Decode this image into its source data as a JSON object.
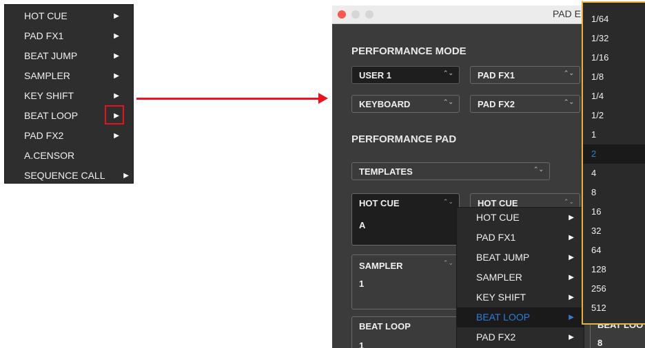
{
  "left_menu": {
    "items": [
      {
        "label": "HOT CUE",
        "arrow": "▶"
      },
      {
        "label": "PAD FX1",
        "arrow": "▶"
      },
      {
        "label": "BEAT JUMP",
        "arrow": "▶"
      },
      {
        "label": "SAMPLER",
        "arrow": "▶"
      },
      {
        "label": "KEY SHIFT",
        "arrow": "▶"
      },
      {
        "label": "BEAT LOOP",
        "arrow": "▶"
      },
      {
        "label": "PAD FX2",
        "arrow": "▶"
      },
      {
        "label": "A.CENSOR",
        "arrow": ""
      },
      {
        "label": "SEQUENCE CALL",
        "arrow": "▶"
      }
    ],
    "highlight_color": "#e8141b"
  },
  "window": {
    "title": "PAD E",
    "traffic_colors": [
      "#fc5753",
      "#d6d6d6",
      "#d6d6d6"
    ],
    "performance_mode": {
      "heading": "PERFORMANCE MODE",
      "row1": [
        "USER 1",
        "PAD FX1"
      ],
      "row2": [
        "KEYBOARD",
        "PAD FX2"
      ]
    },
    "performance_pad": {
      "heading": "PERFORMANCE PAD",
      "templates": "TEMPLATES",
      "pads": [
        {
          "title": "HOT CUE",
          "value": "A"
        },
        {
          "title": "HOT CUE",
          "value": ""
        },
        {
          "title": "SAMPLER",
          "value": "1"
        },
        {
          "title": "BEAT LOOP",
          "value": "1"
        },
        {
          "title": "BEAT LOO",
          "value": "8"
        }
      ]
    },
    "popup": {
      "items": [
        {
          "label": "HOT CUE",
          "arrow": "▶"
        },
        {
          "label": "PAD FX1",
          "arrow": "▶"
        },
        {
          "label": "BEAT JUMP",
          "arrow": "▶"
        },
        {
          "label": "SAMPLER",
          "arrow": "▶"
        },
        {
          "label": "KEY SHIFT",
          "arrow": "▶"
        },
        {
          "label": "BEAT LOOP",
          "arrow": "▶"
        },
        {
          "label": "PAD FX2",
          "arrow": "▶"
        }
      ],
      "active_item": "BEAT LOOP"
    }
  },
  "beat_loop_values": {
    "items": [
      "1/64",
      "1/32",
      "1/16",
      "1/8",
      "1/4",
      "1/2",
      "1",
      "2",
      "4",
      "8",
      "16",
      "32",
      "64",
      "128",
      "256",
      "512"
    ],
    "selected": "2",
    "border_color": "#e7b43a"
  },
  "arrow": {
    "color": "#e8141b"
  },
  "updown_glyph": "⌃⌄"
}
